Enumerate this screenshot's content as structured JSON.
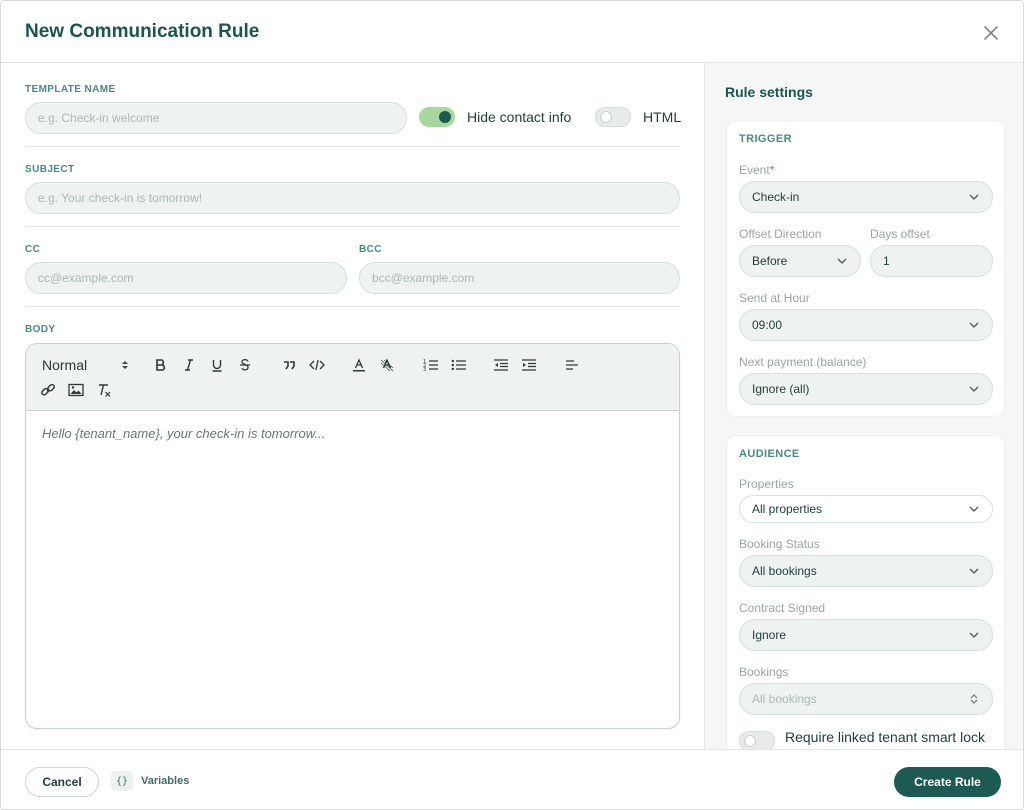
{
  "modal": {
    "title": "New Communication Rule"
  },
  "form": {
    "template_name": {
      "label": "TEMPLATE NAME",
      "placeholder": "e.g. Check-in welcome",
      "value": ""
    },
    "hide_contact": {
      "label": "Hide contact info",
      "on": true
    },
    "html": {
      "label": "HTML",
      "on": false
    },
    "subject": {
      "label": "SUBJECT",
      "placeholder": "e.g. Your check-in is tomorrow!",
      "value": ""
    },
    "cc": {
      "label": "CC",
      "placeholder": "cc@example.com",
      "value": ""
    },
    "bcc": {
      "label": "BCC",
      "placeholder": "bcc@example.com",
      "value": ""
    },
    "body": {
      "label": "BODY",
      "format": "Normal",
      "placeholder": "Hello {tenant_name}, your check-in is tomorrow...",
      "toolbar": [
        "bold-icon",
        "italic-icon",
        "underline-icon",
        "strikethrough-icon",
        "quote-icon",
        "code-icon",
        "text-color-icon",
        "highlight-icon",
        "ordered-list-icon",
        "bullet-list-icon",
        "outdent-icon",
        "indent-icon",
        "align-left-icon",
        "link-icon",
        "image-icon",
        "clear-format-icon"
      ]
    }
  },
  "settings": {
    "title": "Rule settings",
    "trigger": {
      "label": "TRIGGER",
      "event": {
        "label": "Event",
        "required_mark": "*",
        "value": "Check-in"
      },
      "offset_direction": {
        "label": "Offset Direction",
        "value": "Before"
      },
      "days_offset": {
        "label": "Days offset",
        "value": "1"
      },
      "send_hour": {
        "label": "Send at Hour",
        "value": "09:00"
      },
      "next_payment": {
        "label": "Next payment (balance)",
        "value": "Ignore (all)"
      }
    },
    "audience": {
      "label": "AUDIENCE",
      "properties": {
        "label": "Properties",
        "value": "All properties"
      },
      "booking_status": {
        "label": "Booking Status",
        "value": "All bookings"
      },
      "contract_signed": {
        "label": "Contract Signed",
        "value": "Ignore"
      },
      "bookings": {
        "label": "Bookings",
        "value": "All bookings"
      },
      "require_lock": {
        "label": "Require linked tenant smart lock access",
        "on": false
      }
    }
  },
  "footer": {
    "cancel_label": "Cancel",
    "variables_icon": "{}",
    "variables_label": "Variables",
    "create_label": "Create Rule"
  },
  "colors": {
    "accent": "#1d5a54",
    "toggle_on": "#a6d89e",
    "label": "#4a8a80"
  }
}
